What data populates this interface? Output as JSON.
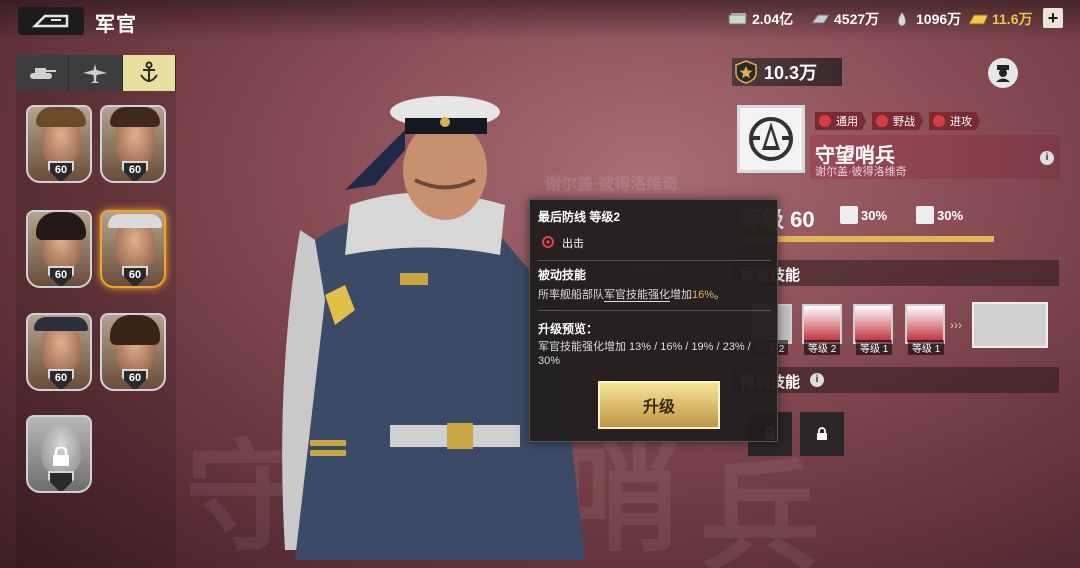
{
  "header": {
    "title": "军官",
    "resources": [
      {
        "icon": "cash-stack-icon",
        "value": "2.04亿"
      },
      {
        "icon": "steel-ingot-icon",
        "value": "4527万"
      },
      {
        "icon": "oil-barrel-icon",
        "value": "1096万"
      },
      {
        "icon": "gold-bar-icon",
        "value": "11.6万"
      }
    ],
    "plus_label": "+"
  },
  "left": {
    "tabs": [
      {
        "icon": "tank-icon",
        "active": false
      },
      {
        "icon": "plane-icon",
        "active": false
      },
      {
        "icon": "anchor-icon",
        "active": true
      }
    ],
    "officers": [
      {
        "level": "60",
        "selected": false,
        "locked": false
      },
      {
        "level": "60",
        "selected": false,
        "locked": false
      },
      {
        "level": "60",
        "selected": false,
        "locked": false
      },
      {
        "level": "60",
        "selected": true,
        "locked": false
      },
      {
        "level": "60",
        "selected": false,
        "locked": false
      },
      {
        "level": "60",
        "selected": false,
        "locked": false
      },
      {
        "level": "",
        "selected": false,
        "locked": true
      }
    ]
  },
  "background_text": {
    "watermark_name": "谢尔盖·彼得洛维奇",
    "big_chars": [
      "守",
      "哨",
      "兵"
    ]
  },
  "right": {
    "power": "10.3万",
    "tags": [
      "通用",
      "野战",
      "进攻"
    ],
    "name": "守望哨兵",
    "subname": "谢尔盖·彼得洛维奇",
    "level_label": "等级 60",
    "stats": [
      "30%",
      "30%"
    ],
    "officer_skills_title": "军官技能",
    "skills": [
      {
        "level_label": "等级 2"
      },
      {
        "level_label": "等级 2"
      },
      {
        "level_label": "等级 1"
      },
      {
        "level_label": "等级 1"
      }
    ],
    "special_skills_title": "特训技能"
  },
  "tooltip": {
    "title": "最后防线 等级2",
    "type": "出击",
    "passive_heading": "被动技能",
    "passive_text_pre": "所率舰船部队",
    "passive_text_link": "军官技能强化",
    "passive_text_mid": "增加",
    "passive_text_value": "16%",
    "passive_text_post": "。",
    "preview_heading": "升级预览：",
    "preview_text": "军官技能强化增加   13% / 16% / 19% / 23% / 30%",
    "upgrade_label": "升级"
  },
  "colors": {
    "accent_gold": "#e3b853",
    "selected_border": "#f0a531",
    "tag_red": "#7a2a33"
  }
}
